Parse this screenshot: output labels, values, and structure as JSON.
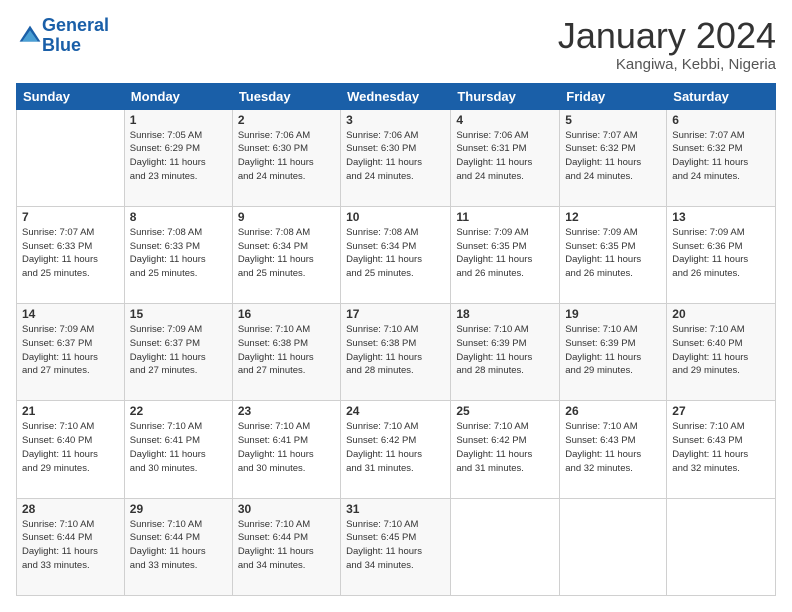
{
  "logo": {
    "line1": "General",
    "line2": "Blue"
  },
  "title": "January 2024",
  "subtitle": "Kangiwa, Kebbi, Nigeria",
  "headers": [
    "Sunday",
    "Monday",
    "Tuesday",
    "Wednesday",
    "Thursday",
    "Friday",
    "Saturday"
  ],
  "weeks": [
    [
      {
        "day": "",
        "info": ""
      },
      {
        "day": "1",
        "info": "Sunrise: 7:05 AM\nSunset: 6:29 PM\nDaylight: 11 hours\nand 23 minutes."
      },
      {
        "day": "2",
        "info": "Sunrise: 7:06 AM\nSunset: 6:30 PM\nDaylight: 11 hours\nand 24 minutes."
      },
      {
        "day": "3",
        "info": "Sunrise: 7:06 AM\nSunset: 6:30 PM\nDaylight: 11 hours\nand 24 minutes."
      },
      {
        "day": "4",
        "info": "Sunrise: 7:06 AM\nSunset: 6:31 PM\nDaylight: 11 hours\nand 24 minutes."
      },
      {
        "day": "5",
        "info": "Sunrise: 7:07 AM\nSunset: 6:32 PM\nDaylight: 11 hours\nand 24 minutes."
      },
      {
        "day": "6",
        "info": "Sunrise: 7:07 AM\nSunset: 6:32 PM\nDaylight: 11 hours\nand 24 minutes."
      }
    ],
    [
      {
        "day": "7",
        "info": "Sunrise: 7:07 AM\nSunset: 6:33 PM\nDaylight: 11 hours\nand 25 minutes."
      },
      {
        "day": "8",
        "info": "Sunrise: 7:08 AM\nSunset: 6:33 PM\nDaylight: 11 hours\nand 25 minutes."
      },
      {
        "day": "9",
        "info": "Sunrise: 7:08 AM\nSunset: 6:34 PM\nDaylight: 11 hours\nand 25 minutes."
      },
      {
        "day": "10",
        "info": "Sunrise: 7:08 AM\nSunset: 6:34 PM\nDaylight: 11 hours\nand 25 minutes."
      },
      {
        "day": "11",
        "info": "Sunrise: 7:09 AM\nSunset: 6:35 PM\nDaylight: 11 hours\nand 26 minutes."
      },
      {
        "day": "12",
        "info": "Sunrise: 7:09 AM\nSunset: 6:35 PM\nDaylight: 11 hours\nand 26 minutes."
      },
      {
        "day": "13",
        "info": "Sunrise: 7:09 AM\nSunset: 6:36 PM\nDaylight: 11 hours\nand 26 minutes."
      }
    ],
    [
      {
        "day": "14",
        "info": "Sunrise: 7:09 AM\nSunset: 6:37 PM\nDaylight: 11 hours\nand 27 minutes."
      },
      {
        "day": "15",
        "info": "Sunrise: 7:09 AM\nSunset: 6:37 PM\nDaylight: 11 hours\nand 27 minutes."
      },
      {
        "day": "16",
        "info": "Sunrise: 7:10 AM\nSunset: 6:38 PM\nDaylight: 11 hours\nand 27 minutes."
      },
      {
        "day": "17",
        "info": "Sunrise: 7:10 AM\nSunset: 6:38 PM\nDaylight: 11 hours\nand 28 minutes."
      },
      {
        "day": "18",
        "info": "Sunrise: 7:10 AM\nSunset: 6:39 PM\nDaylight: 11 hours\nand 28 minutes."
      },
      {
        "day": "19",
        "info": "Sunrise: 7:10 AM\nSunset: 6:39 PM\nDaylight: 11 hours\nand 29 minutes."
      },
      {
        "day": "20",
        "info": "Sunrise: 7:10 AM\nSunset: 6:40 PM\nDaylight: 11 hours\nand 29 minutes."
      }
    ],
    [
      {
        "day": "21",
        "info": "Sunrise: 7:10 AM\nSunset: 6:40 PM\nDaylight: 11 hours\nand 29 minutes."
      },
      {
        "day": "22",
        "info": "Sunrise: 7:10 AM\nSunset: 6:41 PM\nDaylight: 11 hours\nand 30 minutes."
      },
      {
        "day": "23",
        "info": "Sunrise: 7:10 AM\nSunset: 6:41 PM\nDaylight: 11 hours\nand 30 minutes."
      },
      {
        "day": "24",
        "info": "Sunrise: 7:10 AM\nSunset: 6:42 PM\nDaylight: 11 hours\nand 31 minutes."
      },
      {
        "day": "25",
        "info": "Sunrise: 7:10 AM\nSunset: 6:42 PM\nDaylight: 11 hours\nand 31 minutes."
      },
      {
        "day": "26",
        "info": "Sunrise: 7:10 AM\nSunset: 6:43 PM\nDaylight: 11 hours\nand 32 minutes."
      },
      {
        "day": "27",
        "info": "Sunrise: 7:10 AM\nSunset: 6:43 PM\nDaylight: 11 hours\nand 32 minutes."
      }
    ],
    [
      {
        "day": "28",
        "info": "Sunrise: 7:10 AM\nSunset: 6:44 PM\nDaylight: 11 hours\nand 33 minutes."
      },
      {
        "day": "29",
        "info": "Sunrise: 7:10 AM\nSunset: 6:44 PM\nDaylight: 11 hours\nand 33 minutes."
      },
      {
        "day": "30",
        "info": "Sunrise: 7:10 AM\nSunset: 6:44 PM\nDaylight: 11 hours\nand 34 minutes."
      },
      {
        "day": "31",
        "info": "Sunrise: 7:10 AM\nSunset: 6:45 PM\nDaylight: 11 hours\nand 34 minutes."
      },
      {
        "day": "",
        "info": ""
      },
      {
        "day": "",
        "info": ""
      },
      {
        "day": "",
        "info": ""
      }
    ]
  ]
}
